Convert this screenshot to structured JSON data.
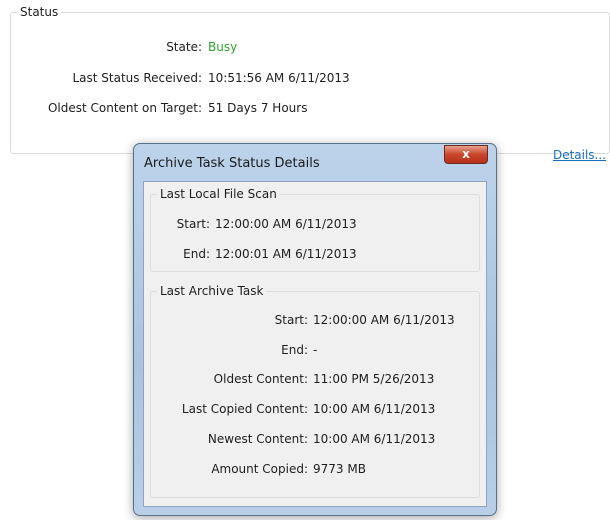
{
  "status_group": {
    "legend": "Status",
    "state_label": "State:",
    "state_value": "Busy",
    "last_status_label": "Last Status Received:",
    "last_status_value": "10:51:56 AM 6/11/2013",
    "oldest_label": "Oldest Content on Target:",
    "oldest_value": "51 Days 7 Hours",
    "details_link": "Details..."
  },
  "dialog": {
    "title": "Archive Task Status Details",
    "close_glyph": "x",
    "local_scan": {
      "legend": "Last Local File Scan",
      "start_label": "Start:",
      "start_value": "12:00:00 AM 6/11/2013",
      "end_label": "End:",
      "end_value": "12:00:01 AM 6/11/2013"
    },
    "archive_task": {
      "legend": "Last Archive Task",
      "rows": [
        {
          "label": "Start:",
          "value": "12:00:00 AM 6/11/2013"
        },
        {
          "label": "End:",
          "value": "-"
        },
        {
          "label": "Oldest Content:",
          "value": "11:00 PM 5/26/2013"
        },
        {
          "label": "Last Copied Content:",
          "value": "10:00 AM 6/11/2013"
        },
        {
          "label": "Newest Content:",
          "value": "10:00 AM 6/11/2013"
        },
        {
          "label": "Amount Copied:",
          "value": "9773 MB"
        }
      ]
    }
  },
  "colors": {
    "busy": "#2ea22e",
    "link": "#1a6fbf",
    "close_button": "#c9442a"
  }
}
